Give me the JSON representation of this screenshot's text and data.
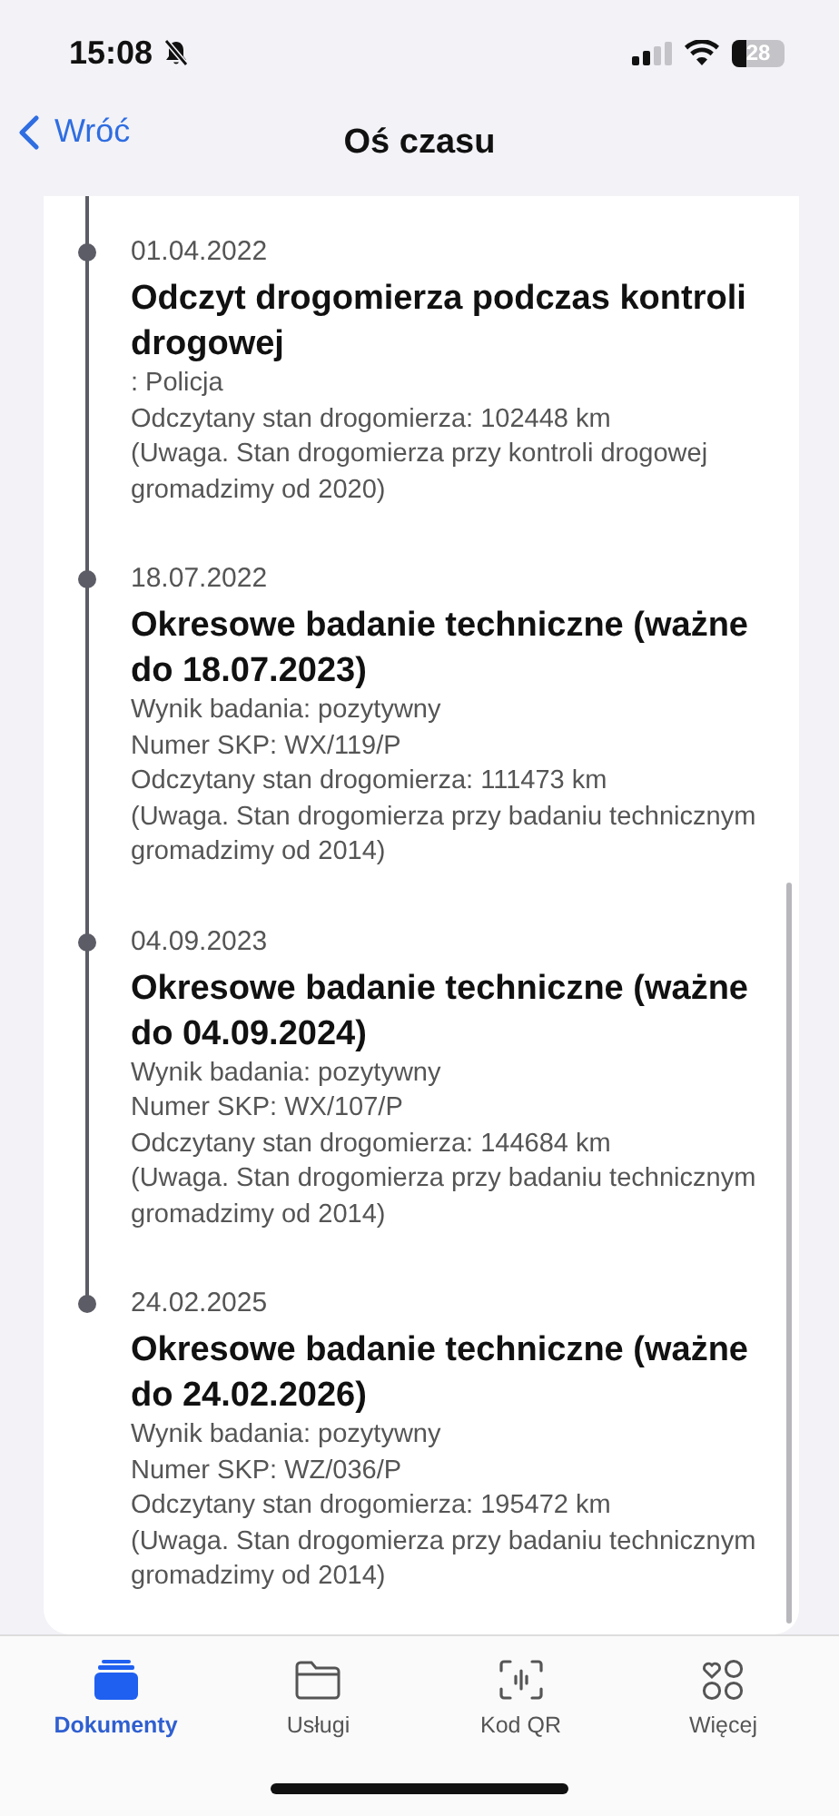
{
  "status_bar": {
    "time": "15:08",
    "battery": "28"
  },
  "nav": {
    "back": "Wróć",
    "title": "Oś czasu"
  },
  "events": [
    {
      "date": "01.04.2022",
      "title": "Odczyt drogomierza podczas kontroli drogowej",
      "details": [
        ": Policja",
        "Odczytany stan drogomierza: 102448 km",
        "(Uwaga. Stan drogomierza przy kontroli drogowej gromadzimy od 2020)"
      ]
    },
    {
      "date": "18.07.2022",
      "title": "Okresowe badanie techniczne (ważne do 18.07.2023)",
      "details": [
        "Wynik badania: pozytywny",
        "Numer SKP: WX/119/P",
        "Odczytany stan drogomierza: 111473 km",
        "(Uwaga. Stan drogomierza przy badaniu technicznym gromadzimy od 2014)"
      ]
    },
    {
      "date": "04.09.2023",
      "title": "Okresowe badanie techniczne (ważne do 04.09.2024)",
      "details": [
        "Wynik badania: pozytywny",
        "Numer SKP: WX/107/P",
        "Odczytany stan drogomierza: 144684 km",
        "(Uwaga. Stan drogomierza przy badaniu technicznym gromadzimy od 2014)"
      ]
    },
    {
      "date": "24.02.2025",
      "title": "Okresowe badanie techniczne (ważne do 24.02.2026)",
      "details": [
        "Wynik badania: pozytywny",
        "Numer SKP: WZ/036/P",
        "Odczytany stan drogomierza: 195472 km",
        "(Uwaga. Stan drogomierza przy badaniu technicznym gromadzimy od 2014)"
      ]
    }
  ],
  "tabs": [
    {
      "kind": "documents",
      "label": "Dokumenty",
      "selected": true
    },
    {
      "kind": "services",
      "label": "Usługi",
      "selected": false
    },
    {
      "kind": "qr",
      "label": "Kod QR",
      "selected": false
    },
    {
      "kind": "more",
      "label": "Więcej",
      "selected": false
    }
  ]
}
